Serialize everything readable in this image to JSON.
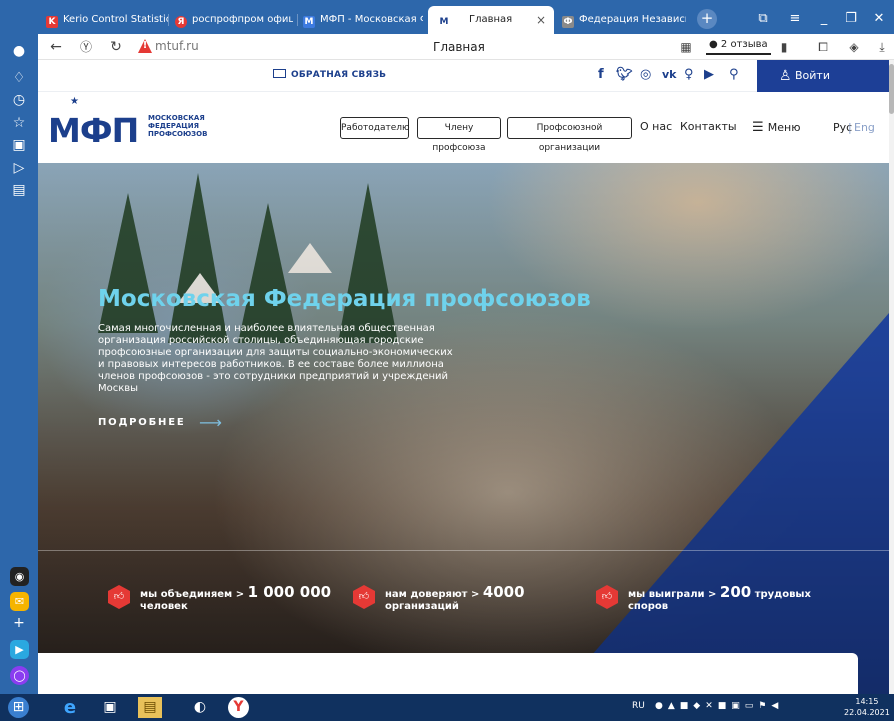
{
  "browser": {
    "tabs": [
      {
        "label": "Kerio Control Statistics",
        "color": "#e53935",
        "icon": "K"
      },
      {
        "label": "роспрофпром официа",
        "color": "#e53935",
        "icon": "Я"
      },
      {
        "label": "МФП - Московская Фе",
        "color": "#3d7be0",
        "icon": "M"
      },
      {
        "label": "Главная",
        "color": "#1c3f8c",
        "icon": "M"
      },
      {
        "label": "Федерация Независим",
        "color": "#6a6a6a",
        "icon": "Ф"
      }
    ],
    "active_tab_close": "×",
    "new_tab": "+",
    "address": {
      "domain": "mtuf.ru",
      "page_title": "Главная",
      "reviews": "2 отзыва"
    }
  },
  "site": {
    "topbar": {
      "feedback": "ОБРАТНАЯ СВЯЗЬ",
      "social": [
        "f",
        "y",
        "◎",
        "vk",
        "ok",
        "▶"
      ],
      "login": "Войти"
    },
    "logo": {
      "text": "МФП",
      "sub": [
        "МОСКОВСКАЯ",
        "ФЕДЕРАЦИЯ",
        "ПРОФСОЮЗОВ"
      ]
    },
    "nav": {
      "pills": [
        "Работодателю",
        "Члену профсоюза",
        "Профсоюзной организации"
      ],
      "links": [
        "О нас",
        "Контакты"
      ],
      "menu": "Меню",
      "lang_ru": "Рус",
      "lang_sep": "|",
      "lang_en": "Eng"
    },
    "hero": {
      "title": "Московская Федерация профсоюзов",
      "text": "Самая многочисленная и наиболее влиятельная общественная организация российской столицы, объединяющая городские профсоюзные организации для защиты социально-экономических и правовых интересов работников. В ее составе более миллиона членов профсоюзов - это сотрудники предприятий и учреждений Москвы",
      "more": "ПОДРОБНЕЕ"
    },
    "stats": [
      {
        "prefix": "мы объединяем >",
        "value": "1 000 000",
        "suffix": "",
        "line2": "человек"
      },
      {
        "prefix": "нам доверяют >",
        "value": "4000",
        "suffix": "",
        "line2": "организаций"
      },
      {
        "prefix": "мы выиграли >",
        "value": "200",
        "suffix": "трудовых",
        "line2": "споров"
      }
    ]
  },
  "taskbar": {
    "lang": "RU",
    "time": "14:15",
    "date": "22.04.2021"
  }
}
